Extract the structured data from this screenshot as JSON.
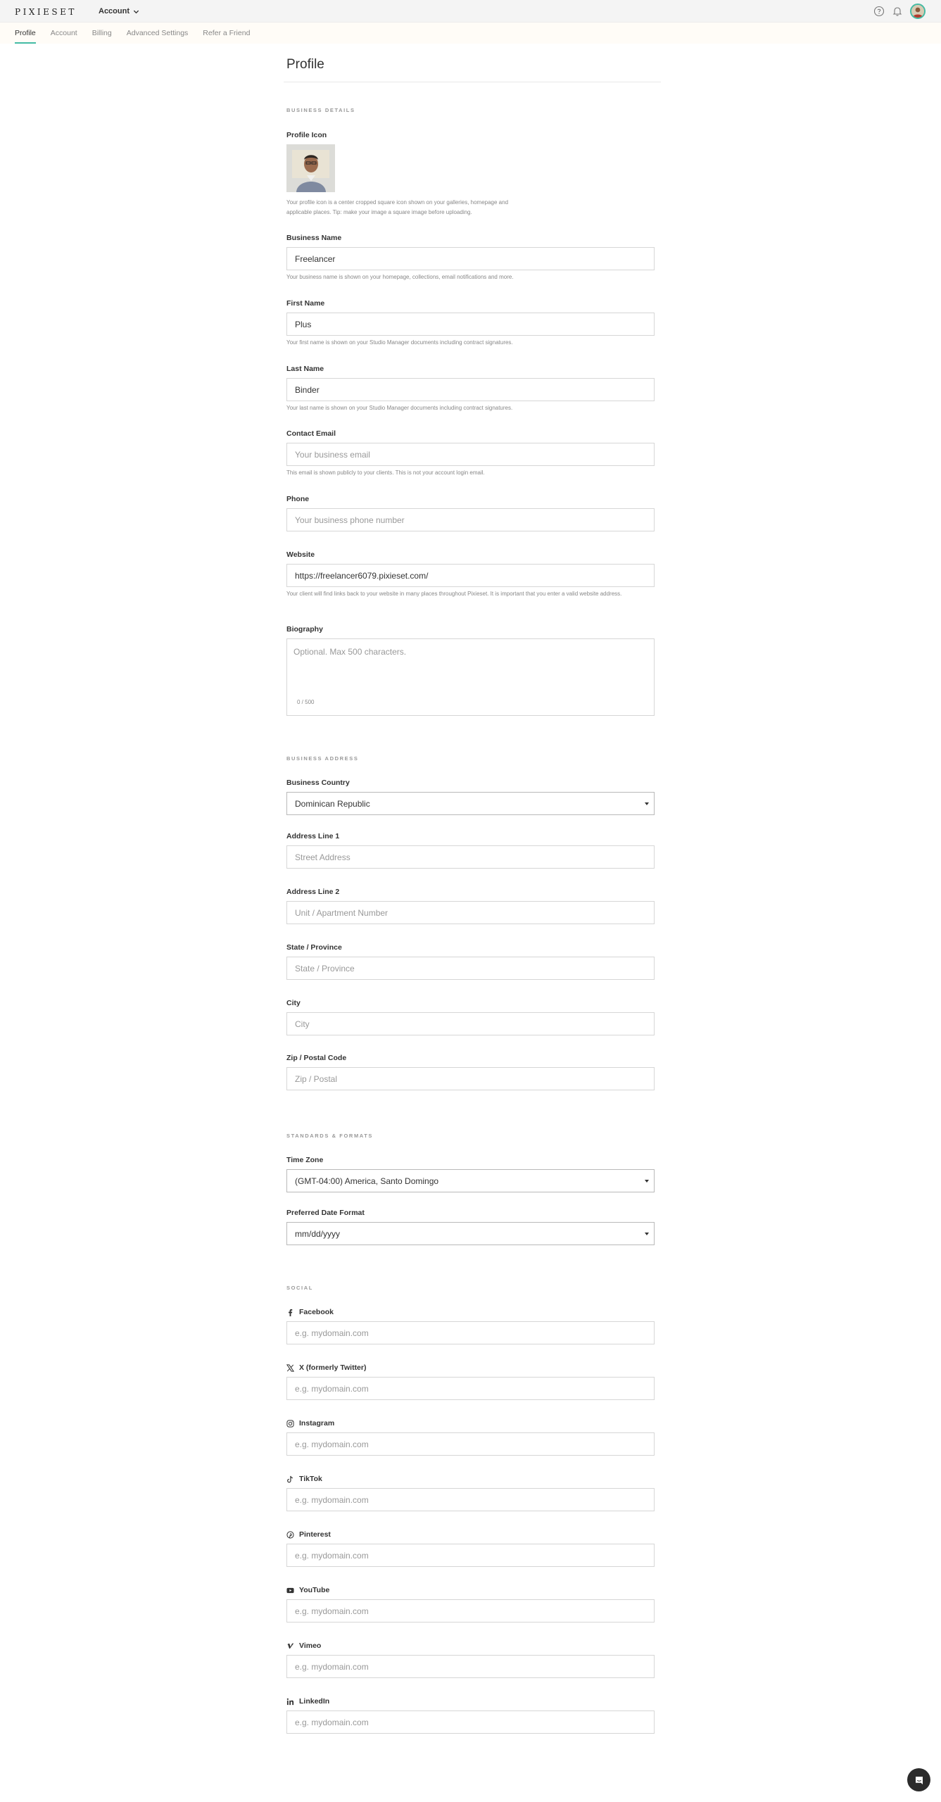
{
  "app": {
    "logo": "PIXIESET",
    "account_menu": "Account"
  },
  "tabs": [
    {
      "label": "Profile",
      "active": true
    },
    {
      "label": "Account",
      "active": false
    },
    {
      "label": "Billing",
      "active": false
    },
    {
      "label": "Advanced Settings",
      "active": false
    },
    {
      "label": "Refer a Friend",
      "active": false
    }
  ],
  "header_icons": [
    "help-icon",
    "bell-icon",
    "avatar"
  ],
  "page_title": "Profile",
  "sections": {
    "business_details": "BUSINESS DETAILS",
    "business_address": "BUSINESS ADDRESS",
    "standards": "STANDARDS & FORMATS",
    "social": "SOCIAL"
  },
  "profile_icon": {
    "label": "Profile Icon",
    "help": "Your profile icon is a center cropped square icon shown on your galleries, homepage and applicable places. Tip: make your image a square image before uploading."
  },
  "fields": {
    "business_name": {
      "label": "Business Name",
      "value": "Freelancer",
      "help": "Your business name is shown on your homepage, collections, email notifications and more."
    },
    "first_name": {
      "label": "First Name",
      "value": "Plus",
      "help": "Your first name is shown on your Studio Manager documents including contract signatures."
    },
    "last_name": {
      "label": "Last Name",
      "value": "Binder",
      "help": "Your last name is shown on your Studio Manager documents including contract signatures."
    },
    "contact_email": {
      "label": "Contact Email",
      "placeholder": "Your business email",
      "help": "This email is shown publicly to your clients. This is not your account login email."
    },
    "phone": {
      "label": "Phone",
      "placeholder": "Your business phone number"
    },
    "website": {
      "label": "Website",
      "value": "https://freelancer6079.pixieset.com/",
      "help": "Your client will find links back to your website in many places throughout Pixieset. It is important that you enter a valid website address."
    },
    "biography": {
      "label": "Biography",
      "placeholder": "Optional. Max 500 characters.",
      "count": "0 / 500"
    },
    "country": {
      "label": "Business Country",
      "value": "Dominican Republic"
    },
    "address1": {
      "label": "Address Line 1",
      "placeholder": "Street Address"
    },
    "address2": {
      "label": "Address Line 2",
      "placeholder": "Unit / Apartment Number"
    },
    "state": {
      "label": "State / Province",
      "placeholder": "State / Province"
    },
    "city": {
      "label": "City",
      "placeholder": "City"
    },
    "zip": {
      "label": "Zip / Postal Code",
      "placeholder": "Zip / Postal"
    },
    "timezone": {
      "label": "Time Zone",
      "value": "(GMT-04:00) America, Santo Domingo"
    },
    "date_format": {
      "label": "Preferred Date Format",
      "value": "mm/dd/yyyy"
    }
  },
  "social": [
    {
      "label": "Facebook",
      "icon": "facebook-icon",
      "placeholder": "e.g. mydomain.com"
    },
    {
      "label": "X (formerly Twitter)",
      "icon": "x-twitter-icon",
      "placeholder": "e.g. mydomain.com"
    },
    {
      "label": "Instagram",
      "icon": "instagram-icon",
      "placeholder": "e.g. mydomain.com"
    },
    {
      "label": "TikTok",
      "icon": "tiktok-icon",
      "placeholder": "e.g. mydomain.com"
    },
    {
      "label": "Pinterest",
      "icon": "pinterest-icon",
      "placeholder": "e.g. mydomain.com"
    },
    {
      "label": "YouTube",
      "icon": "youtube-icon",
      "placeholder": "e.g. mydomain.com"
    },
    {
      "label": "Vimeo",
      "icon": "vimeo-icon",
      "placeholder": "e.g. mydomain.com"
    },
    {
      "label": "LinkedIn",
      "icon": "linkedin-icon",
      "placeholder": "e.g. mydomain.com"
    }
  ],
  "colors": {
    "accent": "#44bba4",
    "topbar": "#f4f4f4",
    "subnav": "#fffcf7",
    "chat": "#2b2b2b"
  }
}
